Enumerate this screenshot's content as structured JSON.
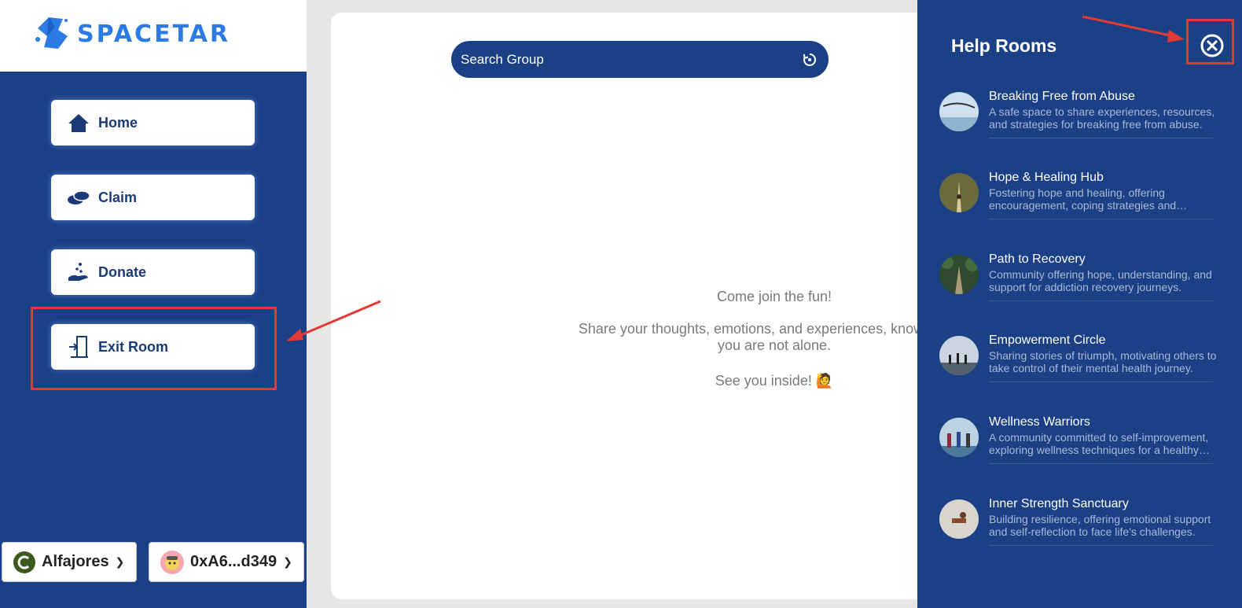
{
  "brand": {
    "name": "SPACETAR"
  },
  "sidebar": {
    "items": [
      {
        "label": "Home",
        "icon": "home-icon"
      },
      {
        "label": "Claim",
        "icon": "coins-icon"
      },
      {
        "label": "Donate",
        "icon": "donate-hand-icon"
      },
      {
        "label": "Exit Room",
        "icon": "exit-door-icon"
      }
    ]
  },
  "wallet": {
    "network_label": "Alfajores",
    "address_label": "0xA6...d349"
  },
  "search": {
    "placeholder": "Search Group"
  },
  "main": {
    "line1": "Come join the fun!",
    "line2": "Share your thoughts, emotions, and experiences, knowing that you are not alone.",
    "line3": "See you inside! 🙋"
  },
  "help_rooms": {
    "title": "Help Rooms",
    "rooms": [
      {
        "name": "Breaking Free from Abuse",
        "description": "A safe space to share experiences, resources, and strategies for breaking free from abuse."
      },
      {
        "name": "Hope & Healing Hub",
        "description": "Fostering hope and healing, offering encouragement, coping strategies and support."
      },
      {
        "name": "Path to Recovery",
        "description": "Community offering hope, understanding, and support for addiction recovery journeys."
      },
      {
        "name": "Empowerment Circle",
        "description": "Sharing stories of triumph, motivating others to take control of their mental health journey."
      },
      {
        "name": "Wellness Warriors",
        "description": "A community committed to self-improvement, exploring wellness techniques for a healthy life."
      },
      {
        "name": "Inner Strength Sanctuary",
        "description": "Building resilience, offering emotional support and self-reflection to face life's challenges."
      }
    ]
  },
  "colors": {
    "primary": "#1b4085",
    "brand_blue": "#2c7be5",
    "annotation_red": "#e53935"
  }
}
